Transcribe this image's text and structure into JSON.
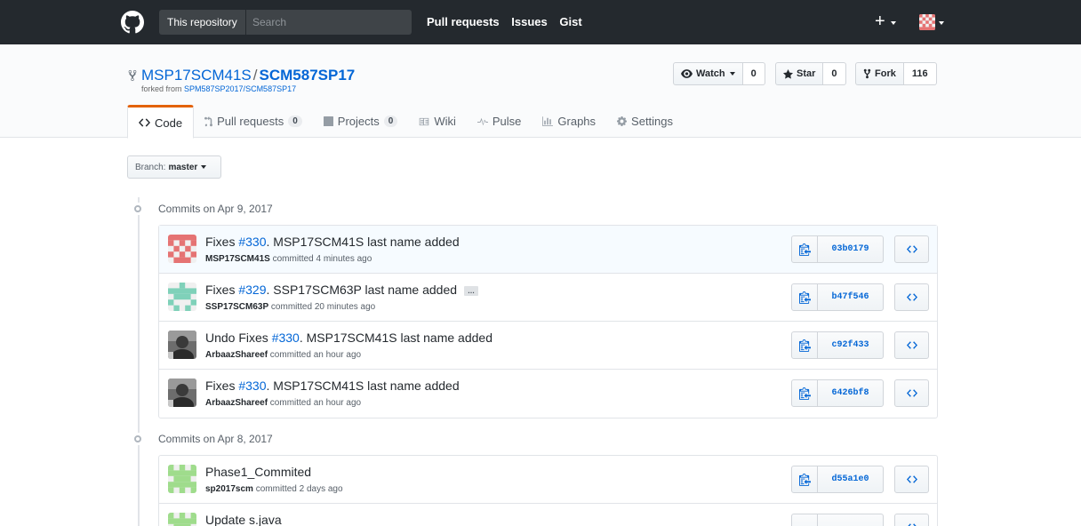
{
  "header": {
    "search_scope": "This repository",
    "search_placeholder": "Search",
    "nav": [
      "Pull requests",
      "Issues",
      "Gist"
    ],
    "plus_label": "+"
  },
  "repo": {
    "owner": "MSP17SCM41S",
    "separator": "/",
    "name": "SCM587SP17",
    "forked_prefix": "forked from ",
    "forked_from": "SPM587SP2017/SCM587SP17",
    "watch_label": "Watch",
    "watch_count": "0",
    "star_label": "Star",
    "star_count": "0",
    "fork_label": "Fork",
    "fork_count": "116"
  },
  "tabs": [
    {
      "label": "Code",
      "icon": "code-icon",
      "selected": true
    },
    {
      "label": "Pull requests",
      "icon": "pull-request-icon",
      "count": "0"
    },
    {
      "label": "Projects",
      "icon": "project-icon",
      "count": "0"
    },
    {
      "label": "Wiki",
      "icon": "book-icon"
    },
    {
      "label": "Pulse",
      "icon": "pulse-icon"
    },
    {
      "label": "Graphs",
      "icon": "graph-icon"
    },
    {
      "label": "Settings",
      "icon": "gear-icon"
    }
  ],
  "branch": {
    "prefix": "Branch:",
    "name": "master"
  },
  "days": [
    {
      "label": "Commits on Apr 9, 2017",
      "commits": [
        {
          "prefix": "Fixes ",
          "issue": "#330",
          "suffix": ". MSP17SCM41S last name added",
          "author": "MSP17SCM41S",
          "time": " committed 4 minutes ago",
          "sha": "03b0179",
          "avatar": "identicon-red"
        },
        {
          "prefix": "Fixes ",
          "issue": "#329",
          "suffix": ". SSP17SCM63P last name added",
          "author": "SSP17SCM63P",
          "time": " committed 20 minutes ago",
          "sha": "b47f546",
          "avatar": "identicon-teal",
          "ellipsis": "…"
        },
        {
          "prefix": "Undo Fixes ",
          "issue": "#330",
          "suffix": ". MSP17SCM41S last name added",
          "author": "ArbaazShareef",
          "time": " committed an hour ago",
          "sha": "c92f433",
          "avatar": "photo"
        },
        {
          "prefix": "Fixes ",
          "issue": "#330",
          "suffix": ". MSP17SCM41S last name added",
          "author": "ArbaazShareef",
          "time": " committed an hour ago",
          "sha": "6426bf8",
          "avatar": "photo"
        }
      ]
    },
    {
      "label": "Commits on Apr 8, 2017",
      "commits": [
        {
          "prefix": "Phase1_Commited",
          "issue": "",
          "suffix": "",
          "author": "sp2017scm",
          "time": " committed 2 days ago",
          "sha": "d55a1e0",
          "avatar": "identicon-green"
        },
        {
          "prefix": "Update s.java",
          "issue": "",
          "suffix": "",
          "author": "",
          "time": "",
          "sha": "",
          "avatar": "identicon-green"
        }
      ]
    }
  ],
  "colors": {
    "header_bg": "#24292e",
    "link": "#0366d6",
    "tab_accent": "#e36209"
  }
}
